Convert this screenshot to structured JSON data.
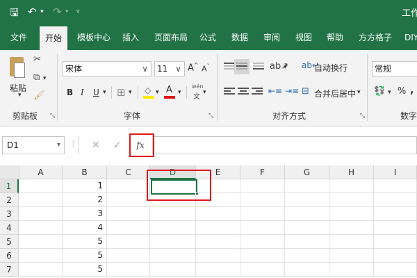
{
  "window": {
    "title_partial": "工作"
  },
  "quick_access": {
    "save_icon": "save-icon",
    "undo_icon": "undo-icon",
    "redo_icon": "redo-icon",
    "customize_icon": "customize-icon"
  },
  "tabs": [
    "文件",
    "开始",
    "模板中心",
    "插入",
    "页面布局",
    "公式",
    "数据",
    "审阅",
    "视图",
    "帮助",
    "方方格子",
    "DIY"
  ],
  "active_tab": "开始",
  "ribbon": {
    "clipboard": {
      "paste_label": "粘贴",
      "group_label": "剪贴板"
    },
    "font": {
      "font_name": "宋体",
      "font_size": "11",
      "bold": "B",
      "italic": "I",
      "underline": "U",
      "grow": "A",
      "shrink": "A",
      "font_color_letter": "A",
      "phonetic": "wén",
      "group_label": "字体"
    },
    "alignment": {
      "wrap_text": "自动换行",
      "merge_center": "合并后居中",
      "group_label": "对齐方式"
    },
    "number": {
      "format": "常规",
      "percent": "%",
      "comma": ",",
      "group_label": "数字"
    }
  },
  "formula_bar": {
    "name_box": "D1",
    "cancel": "✕",
    "enter": "✓",
    "fx": "fx",
    "formula": ""
  },
  "sheet": {
    "columns": [
      "A",
      "B",
      "C",
      "D",
      "E",
      "F",
      "G",
      "H",
      "I"
    ],
    "rows": [
      "1",
      "2",
      "3",
      "4",
      "5",
      "6",
      "7"
    ],
    "column_b_values": [
      "1",
      "2",
      "3",
      "4",
      "5",
      "5",
      "5"
    ],
    "active_cell": "D1"
  },
  "colors": {
    "brand": "#217346",
    "highlight": "#e01818"
  }
}
